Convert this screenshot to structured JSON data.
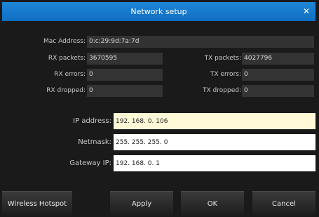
{
  "window": {
    "title": "Network setup",
    "close_glyph": "✕"
  },
  "info": {
    "mac_label": "Mac Address:",
    "mac_value": "0:c:29:9d:7a:7d",
    "rx_packets_label": "RX packets:",
    "rx_packets_value": "3670595",
    "tx_packets_label": "TX packets:",
    "tx_packets_value": "4027796",
    "rx_errors_label": "RX errors:",
    "rx_errors_value": "0",
    "tx_errors_label": "TX errors:",
    "tx_errors_value": "0",
    "rx_dropped_label": "RX dropped:",
    "rx_dropped_value": "0",
    "tx_dropped_label": "TX dropped:",
    "tx_dropped_value": "0"
  },
  "form": {
    "ip_label": "IP address:",
    "ip_value": "192. 168. 0. 106",
    "netmask_label": "Netmask:",
    "netmask_value": "255. 255. 255. 0",
    "gateway_label": "Gateway IP:",
    "gateway_value": "192. 168. 0. 1"
  },
  "buttons": {
    "hotspot": "Wireless Hotspot",
    "apply": "Apply",
    "ok": "OK",
    "cancel": "Cancel"
  },
  "colors": {
    "title_bar": "#1778cc",
    "field_background": "#333333",
    "active_input": "#fff9d8"
  }
}
